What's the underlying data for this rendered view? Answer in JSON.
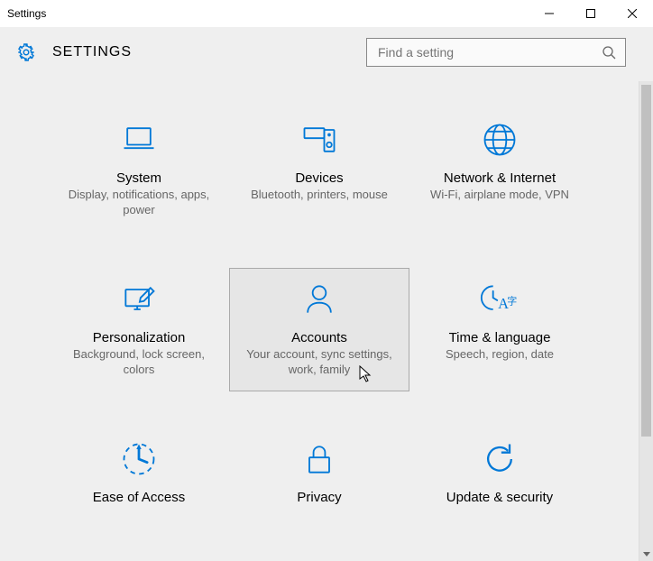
{
  "window": {
    "title": "Settings"
  },
  "header": {
    "title": "SETTINGS"
  },
  "search": {
    "placeholder": "Find a setting"
  },
  "tiles": [
    {
      "title": "System",
      "desc": "Display, notifications, apps, power"
    },
    {
      "title": "Devices",
      "desc": "Bluetooth, printers, mouse"
    },
    {
      "title": "Network & Internet",
      "desc": "Wi-Fi, airplane mode, VPN"
    },
    {
      "title": "Personalization",
      "desc": "Background, lock screen, colors"
    },
    {
      "title": "Accounts",
      "desc": "Your account, sync settings, work, family"
    },
    {
      "title": "Time & language",
      "desc": "Speech, region, date"
    },
    {
      "title": "Ease of Access",
      "desc": ""
    },
    {
      "title": "Privacy",
      "desc": ""
    },
    {
      "title": "Update & security",
      "desc": ""
    }
  ]
}
